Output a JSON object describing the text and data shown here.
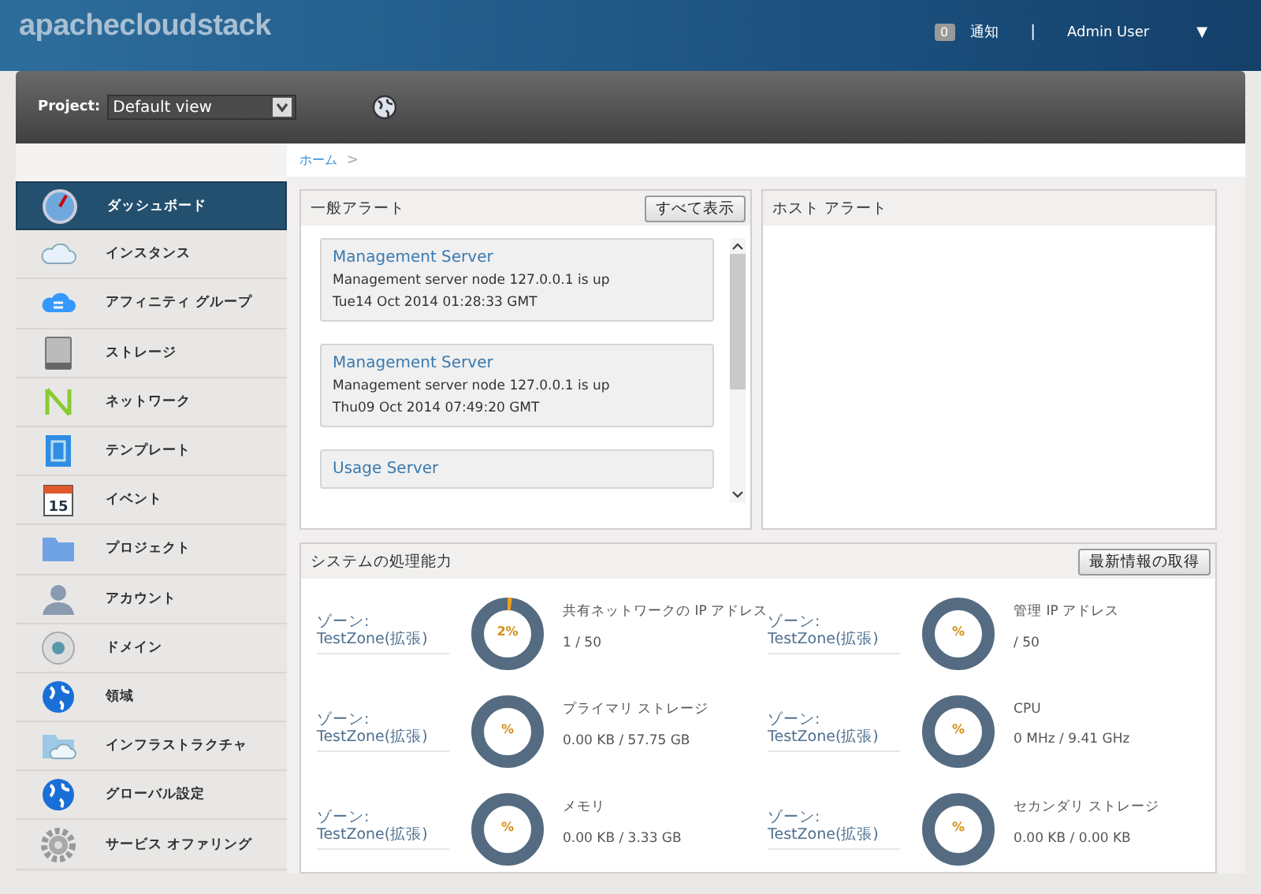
{
  "header": {
    "logo": "apachecloudstack",
    "notification_count": "0",
    "notifications_label": "通知",
    "separator": "|",
    "user": "Admin User",
    "user_menu_caret": "▼"
  },
  "toolbar": {
    "project_label": "Project:",
    "project_value": "Default view"
  },
  "breadcrumb": {
    "items": [
      "ホーム"
    ],
    "separator": ">"
  },
  "sidebar": {
    "items": [
      {
        "label": "ダッシュボード",
        "kind": "dashboard",
        "selected": true
      },
      {
        "label": "インスタンス",
        "kind": "cloud",
        "selected": false
      },
      {
        "label": "アフィニティ グループ",
        "kind": "affinity",
        "selected": false
      },
      {
        "label": "ストレージ",
        "kind": "storage",
        "selected": false
      },
      {
        "label": "ネットワーク",
        "kind": "network",
        "selected": false
      },
      {
        "label": "テンプレート",
        "kind": "template",
        "selected": false
      },
      {
        "label": "イベント",
        "kind": "event",
        "icon_text": "15",
        "selected": false
      },
      {
        "label": "プロジェクト",
        "kind": "folder",
        "selected": false
      },
      {
        "label": "アカウント",
        "kind": "person",
        "selected": false
      },
      {
        "label": "ドメイン",
        "kind": "disc",
        "selected": false
      },
      {
        "label": "領域",
        "kind": "globe",
        "selected": false
      },
      {
        "label": "インフラストラクチャ",
        "kind": "infra",
        "selected": false
      },
      {
        "label": "グローバル設定",
        "kind": "globe2",
        "selected": false
      },
      {
        "label": "サービス オファリング",
        "kind": "gear",
        "selected": false
      }
    ]
  },
  "general_alerts": {
    "title": "一般アラート",
    "view_all_button": "すべて表示",
    "alerts": [
      {
        "title": "Management Server",
        "message": "Management server node 127.0.0.1 is up",
        "time": "Tue14 Oct 2014 01:28:33 GMT"
      },
      {
        "title": "Management Server",
        "message": "Management server node 127.0.0.1 is up",
        "time": "Thu09 Oct 2014 07:49:20 GMT"
      },
      {
        "title": "Usage Server"
      }
    ]
  },
  "host_alerts": {
    "title": "ホスト アラート"
  },
  "capacity": {
    "title": "システムの処理能力",
    "refresh_button": "最新情報の取得",
    "items": [
      {
        "zone_label": "ゾーン:",
        "zone": "TestZone(拡張)",
        "level": 0.02,
        "percent": "2%",
        "name": "共有ネットワークの IP アドレス",
        "value": "1 / 50"
      },
      {
        "zone_label": "ゾーン:",
        "zone": "TestZone(拡張)",
        "level": 0,
        "percent": "%",
        "name": "管理 IP アドレス",
        "value": "/ 50"
      },
      {
        "zone_label": "ゾーン:",
        "zone": "TestZone(拡張)",
        "level": 0,
        "percent": "%",
        "name": "プライマリ ストレージ",
        "value": "0.00 KB / 57.75 GB"
      },
      {
        "zone_label": "ゾーン:",
        "zone": "TestZone(拡張)",
        "level": 0,
        "percent": "%",
        "name": "CPU",
        "value": "0 MHz / 9.41 GHz"
      },
      {
        "zone_label": "ゾーン:",
        "zone": "TestZone(拡張)",
        "level": 0,
        "percent": "%",
        "name": "メモリ",
        "value": "0.00 KB / 3.33 GB"
      },
      {
        "zone_label": "ゾーン:",
        "zone": "TestZone(拡張)",
        "level": 0,
        "percent": "%",
        "name": "セカンダリ ストレージ",
        "value": "0.00 KB / 0.00 KB"
      }
    ]
  }
}
